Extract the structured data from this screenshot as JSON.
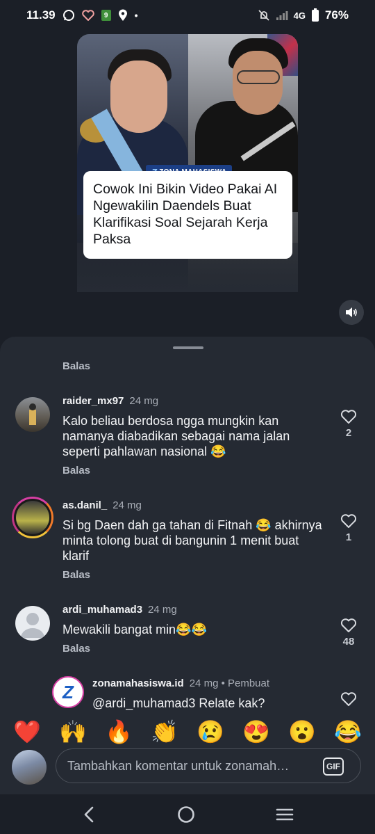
{
  "status": {
    "time": "11.39",
    "network": "4G",
    "battery": "76%"
  },
  "video": {
    "badge": "ZONA MAHASISWA",
    "headline": "Cowok Ini Bikin Video Pakai AI Ngewakilin Daendels Buat Klarifikasi Soal Sejarah Kerja Paksa"
  },
  "comments": {
    "top_reply": "Balas",
    "items": [
      {
        "username": "raider_mx97",
        "time": "24 mg",
        "text": "Kalo beliau berdosa ngga mungkin kan namanya diabadikan sebagai nama jalan seperti pahlawan nasional 😂",
        "reply": "Balas",
        "likes": "2"
      },
      {
        "username": "as.danil_",
        "time": "24 mg",
        "text": "Si bg Daen dah ga tahan di Fitnah 😂 akhirnya minta tolong buat di bangunin 1 menit buat klarif",
        "reply": "Balas",
        "likes": "1"
      },
      {
        "username": "ardi_muhamad3",
        "time": "24 mg",
        "text": "Mewakili bangat min😂😂",
        "reply": "Balas",
        "likes": "48"
      },
      {
        "username": "zonamahasiswa.id",
        "time": "24 mg • Pembuat",
        "text": "@ardi_muhamad3 Relate kak?"
      }
    ]
  },
  "emoji_bar": [
    "❤️",
    "🙌",
    "🔥",
    "👏",
    "😢",
    "😍",
    "😮",
    "😂"
  ],
  "input": {
    "placeholder": "Tambahkan komentar untuk zonamah…",
    "gif_label": "GIF"
  }
}
